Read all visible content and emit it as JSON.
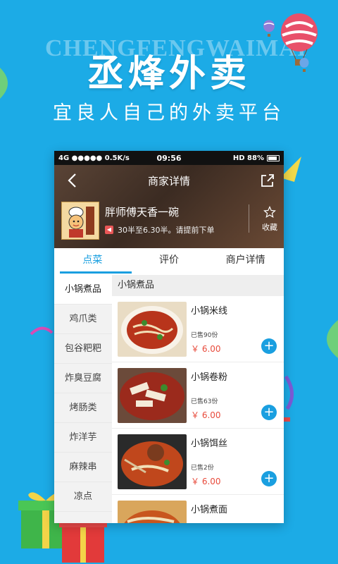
{
  "banner": {
    "watermark_text": "CHENGFENGWAIMAI",
    "title": "丞烽外卖",
    "subtitle": "宜良人自己的外卖平台"
  },
  "status_bar": {
    "left": "4G ●●●●● 0.5K/s",
    "time": "09:56",
    "right": "HD 88%"
  },
  "header": {
    "title": "商家详情",
    "back_icon": "chevron-left-icon",
    "share_icon": "share-icon"
  },
  "shop": {
    "name": "胖师傅天香一碗",
    "hours": "30半至6.30半。请提前下单",
    "favorite_label": "收藏"
  },
  "tabs": [
    {
      "label": "点菜",
      "active": true
    },
    {
      "label": "评价",
      "active": false
    },
    {
      "label": "商户详情",
      "active": false
    }
  ],
  "categories": [
    {
      "label": "小锅煮品",
      "active": true
    },
    {
      "label": "鸡爪类"
    },
    {
      "label": "包谷粑粑"
    },
    {
      "label": "炸臭豆腐"
    },
    {
      "label": "烤肠类"
    },
    {
      "label": "炸洋芋"
    },
    {
      "label": "麻辣串"
    },
    {
      "label": "凉点"
    }
  ],
  "section_title": "小锅煮品",
  "items": [
    {
      "name": "小锅米线",
      "sold": "已售90份",
      "price": "￥ 6.00"
    },
    {
      "name": "小锅卷粉",
      "sold": "已售63份",
      "price": "￥ 6.00"
    },
    {
      "name": "小锅饵丝",
      "sold": "已售2份",
      "price": "￥ 6.00"
    },
    {
      "name": "小锅煮面",
      "sold": "",
      "price": ""
    }
  ],
  "colors": {
    "background": "#1cabe6",
    "accent": "#1a9fe0",
    "price": "#e84b3c"
  }
}
